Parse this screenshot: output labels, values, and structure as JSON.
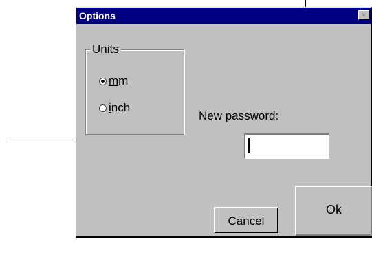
{
  "dialog": {
    "title": "Options",
    "close_label": "×"
  },
  "units_group": {
    "label": "Units",
    "options": [
      {
        "mnemonic": "m",
        "rest": "m",
        "checked": true
      },
      {
        "mnemonic": "i",
        "rest": "nch",
        "checked": false
      }
    ]
  },
  "password": {
    "label": "New password:",
    "value": ""
  },
  "buttons": {
    "cancel": "Cancel",
    "ok": "Ok"
  }
}
